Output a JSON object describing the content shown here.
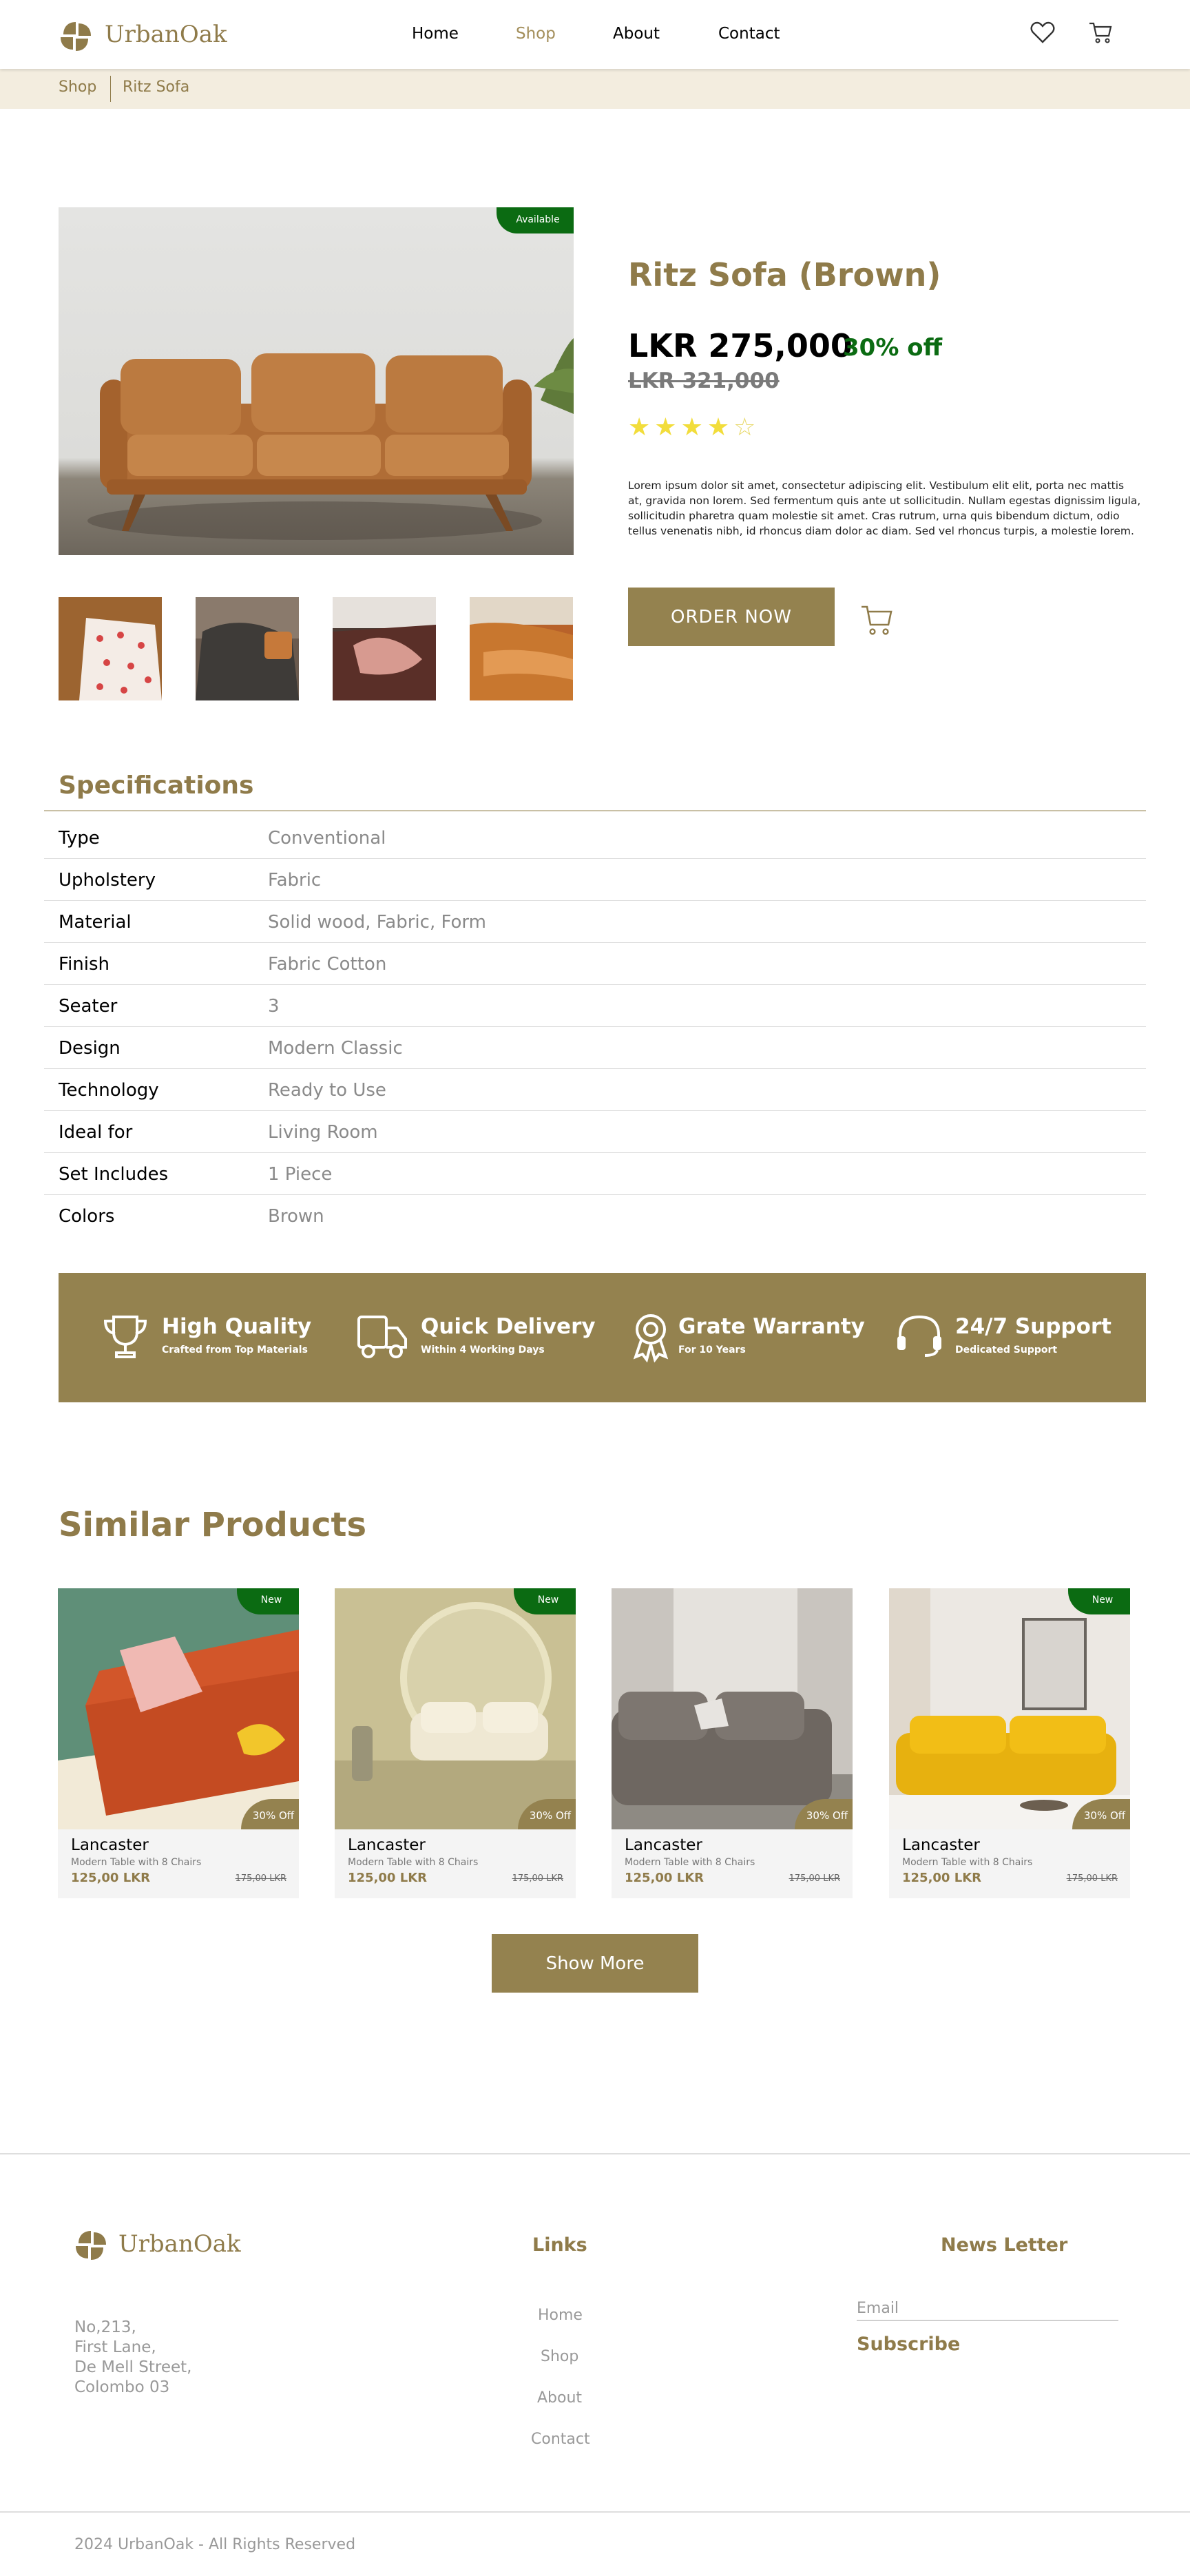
{
  "brand": {
    "name": "UrbanOak",
    "color": "#8f7b4a"
  },
  "nav": {
    "home": "Home",
    "shop": "Shop",
    "about": "About",
    "contact": "Contact",
    "active": "Shop"
  },
  "header_icons": [
    "heart-icon",
    "cart-icon"
  ],
  "breadcrumb": {
    "parent": "Shop",
    "current": "Ritz Sofa"
  },
  "product": {
    "availability": "Available",
    "title": "Ritz Sofa (Brown)",
    "price": "LKR 275,000",
    "discount": "30% off",
    "old_price": "LKR 321,000",
    "rating": 4,
    "rating_max": 5,
    "description": "Lorem ipsum dolor sit amet, consectetur adipiscing elit. Vestibulum elit elit, porta nec mattis at, gravida non lorem. Sed fermentum quis ante ut sollicitudin. Nullam egestas dignissim ligula, sollicitudin pharetra quam molestie sit amet. Cras rutrum, urna quis bibendum dictum, odio tellus venenatis nibh, id rhoncus diam dolor ac diam. Sed vel rhoncus turpis, a molestie lorem.",
    "order_label": "ORDER NOW"
  },
  "specifications": {
    "title": "Specifications",
    "rows": [
      {
        "key": "Type",
        "value": "Conventional"
      },
      {
        "key": "Upholstery",
        "value": "Fabric"
      },
      {
        "key": "Material",
        "value": "Solid wood, Fabric, Form"
      },
      {
        "key": "Finish",
        "value": "Fabric Cotton"
      },
      {
        "key": "Seater",
        "value": "3"
      },
      {
        "key": "Design",
        "value": "Modern Classic"
      },
      {
        "key": "Technology",
        "value": "Ready to Use"
      },
      {
        "key": "Ideal for",
        "value": "Living Room"
      },
      {
        "key": "Set Includes",
        "value": "1 Piece"
      },
      {
        "key": "Colors",
        "value": "Brown"
      }
    ]
  },
  "features": [
    {
      "title": "High Quality",
      "subtitle": "Crafted from Top Materials",
      "icon": "trophy-icon"
    },
    {
      "title": "Quick Delivery",
      "subtitle": "Within 4 Working Days",
      "icon": "truck-icon"
    },
    {
      "title": "Grate Warranty",
      "subtitle": "For 10 Years",
      "icon": "award-icon"
    },
    {
      "title": "24/7 Support",
      "subtitle": "Dedicated Support",
      "icon": "headset-icon"
    }
  ],
  "similar": {
    "title": "Similar Products",
    "items": [
      {
        "badge": "New",
        "off": "30% Off",
        "name": "Lancaster",
        "subtitle": "Modern Table with 8 Chairs",
        "price": "125,00 LKR",
        "old_price": "175,00 LKR"
      },
      {
        "badge": "New",
        "off": "30% Off",
        "name": "Lancaster",
        "subtitle": "Modern Table with 8 Chairs",
        "price": "125,00 LKR",
        "old_price": "175,00 LKR"
      },
      {
        "badge": "",
        "off": "30% Off",
        "name": "Lancaster",
        "subtitle": "Modern Table with 8 Chairs",
        "price": "125,00 LKR",
        "old_price": "175,00 LKR"
      },
      {
        "badge": "New",
        "off": "30% Off",
        "name": "Lancaster",
        "subtitle": "Modern Table with 8 Chairs",
        "price": "125,00 LKR",
        "old_price": "175,00 LKR"
      }
    ],
    "show_more": "Show More"
  },
  "footer": {
    "address": [
      "No,213,",
      "First Lane,",
      "De Mell Street,",
      "Colombo 03"
    ],
    "links_title": "Links",
    "links": [
      "Home",
      "Shop",
      "About",
      "Contact"
    ],
    "newsletter_title": "News Letter",
    "email_placeholder": "Email",
    "subscribe": "Subscribe",
    "copyright": "2024 UrbanOak - All Rights Reserved"
  }
}
